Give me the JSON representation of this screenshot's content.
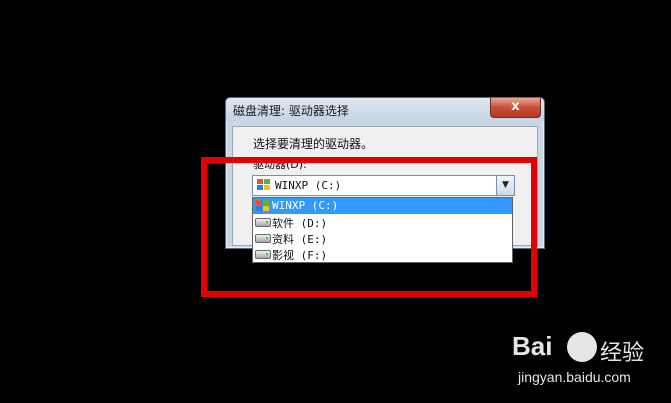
{
  "dialog": {
    "title": "磁盘清理: 驱动器选择",
    "close_label": "x",
    "prompt": "选择要清理的驱动器。",
    "drive_label": "驱动器(D):"
  },
  "combo": {
    "selected": "WINXP (C:)"
  },
  "dropdown": {
    "items": [
      {
        "label": "WINXP (C:)",
        "icon": "windows-xp-icon",
        "selected": true
      },
      {
        "label": "软件 (D:)",
        "icon": "hard-drive-icon",
        "selected": false
      },
      {
        "label": "资料 (E:)",
        "icon": "hard-drive-icon",
        "selected": false
      },
      {
        "label": "影视 (F:)",
        "icon": "hard-drive-icon",
        "selected": false
      }
    ]
  },
  "annotation": {
    "color": "#e00000"
  },
  "watermark": {
    "brand": "Bai",
    "brand_suffix": "经验",
    "url": "jingyan.baidu.com"
  },
  "colors": {
    "selection": "#3399ff",
    "background": "#000000"
  }
}
